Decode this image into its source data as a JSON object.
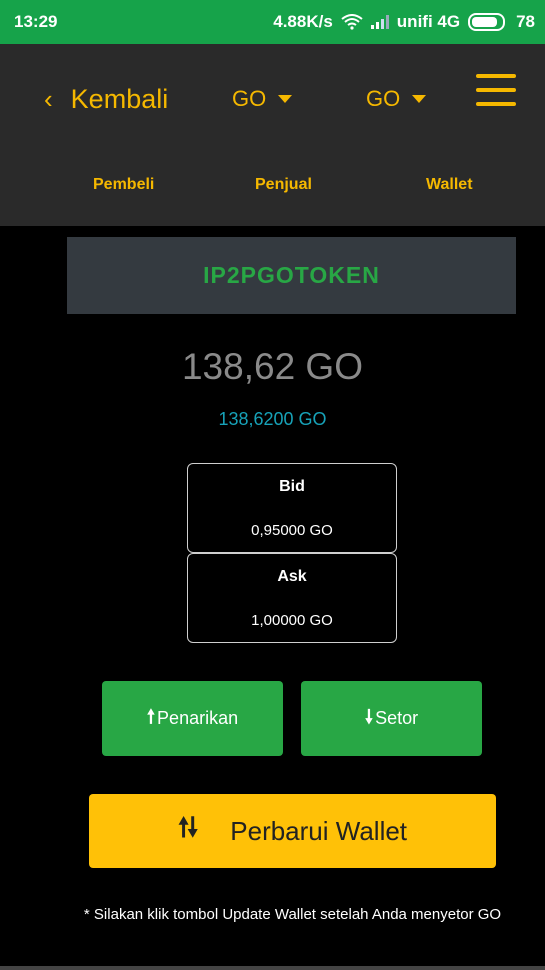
{
  "status_bar": {
    "time": "13:29",
    "network_speed": "4.88K/s",
    "carrier": "unifi 4G",
    "battery": "78",
    "icons": [
      "wifi-icon",
      "signal-icon",
      "battery-icon"
    ],
    "bg_color": "#16a34a"
  },
  "header": {
    "back_label": "Kembali",
    "back_icon": "chevron-left-icon",
    "dropdown1": "GO",
    "dropdown2": "GO",
    "menu_icon": "hamburger-menu-icon",
    "tabs": [
      {
        "label": "Pembeli"
      },
      {
        "label": "Penjual"
      },
      {
        "label": "Wallet"
      }
    ],
    "accent_color": "#f5b800"
  },
  "token": {
    "name": "IP2PGOTOKEN"
  },
  "balance": {
    "main": "138,62 GO",
    "detail": "138,6200 GO"
  },
  "prices": {
    "bid_label": "Bid",
    "bid_value": "0,95000 GO",
    "ask_label": "Ask",
    "ask_value": "1,00000 GO"
  },
  "actions": {
    "withdraw_label": "Penarikan",
    "withdraw_icon": "arrow-up-icon",
    "deposit_label": "Setor",
    "deposit_icon": "arrow-down-icon",
    "update_label": "Perbarui Wallet",
    "update_icon": "arrows-up-down-icon"
  },
  "note": "* Silakan klik tombol Update Wallet setelah Anda menyetor GO",
  "colors": {
    "green": "#28a745",
    "yellow": "#ffc107",
    "teal": "#17a2b8"
  }
}
